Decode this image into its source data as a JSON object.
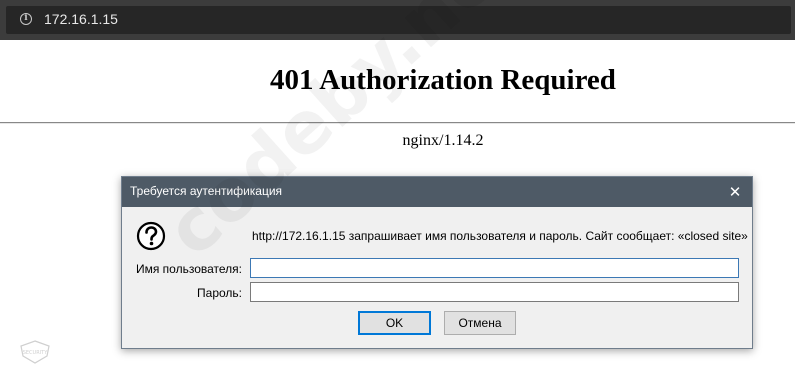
{
  "browser": {
    "url": "172.16.1.15",
    "info_icon_glyph": "i"
  },
  "page": {
    "heading": "401 Authorization Required",
    "server_signature": "nginx/1.14.2"
  },
  "watermark": {
    "text": "codeby.net",
    "logo_text": "SECURITY"
  },
  "dialog": {
    "title": "Требуется аутентификация",
    "close_glyph": "✕",
    "message": "http://172.16.1.15 запрашивает имя пользователя и пароль. Сайт сообщает: «closed site»",
    "username_label": "Имя пользователя:",
    "username_value": "",
    "password_label": "Пароль:",
    "password_value": "",
    "ok_label": "OK",
    "cancel_label": "Отмена"
  },
  "colors": {
    "titlebar": "#4e5a66",
    "urlbar": "#3c3c3c",
    "focus_border": "#0078d7"
  },
  "icons": {
    "info": "info-icon",
    "question": "question-icon",
    "close": "close-icon"
  }
}
